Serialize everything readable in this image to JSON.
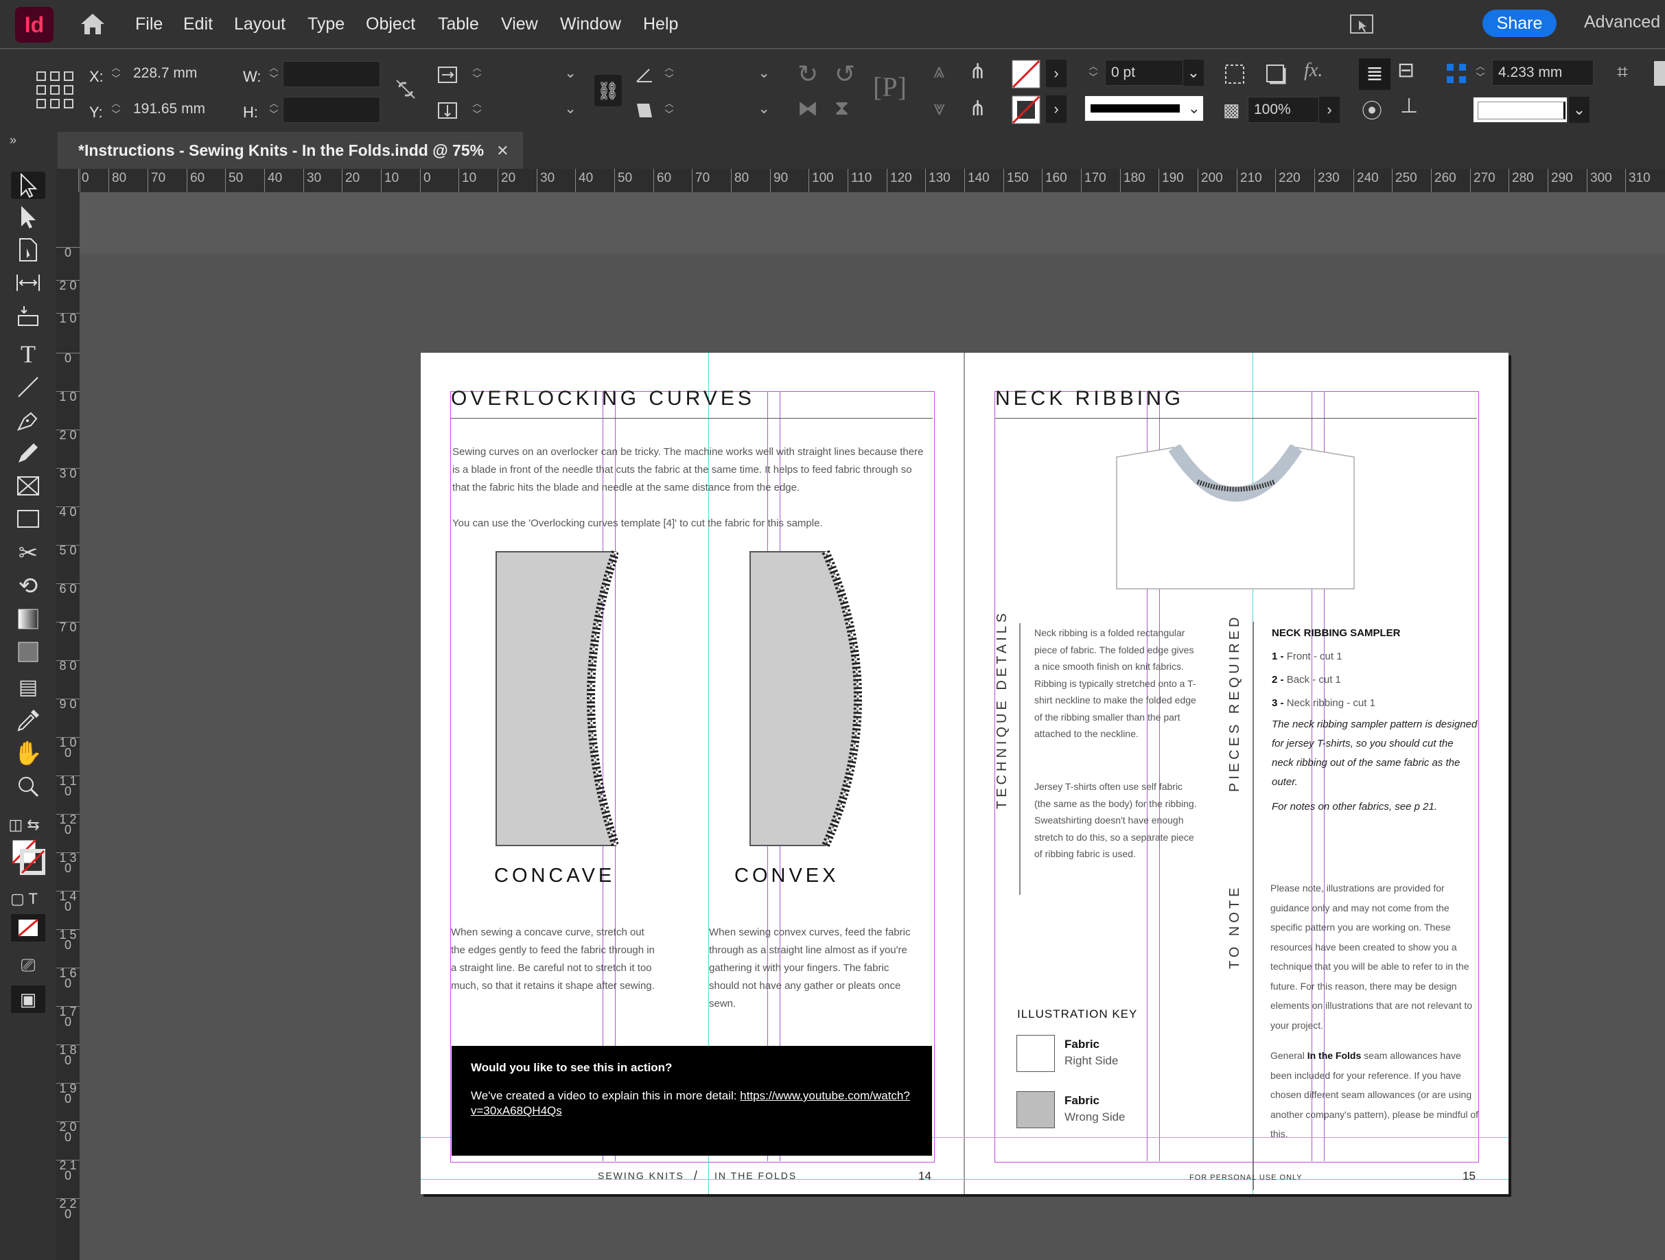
{
  "app": {
    "logo": "Id",
    "menu": [
      "File",
      "Edit",
      "Layout",
      "Type",
      "Object",
      "Table",
      "View",
      "Window",
      "Help"
    ],
    "share_label": "Share",
    "workspace_label": "Advanced"
  },
  "control": {
    "x_label": "X:",
    "x_value": "228.7 mm",
    "y_label": "Y:",
    "y_value": "191.65 mm",
    "w_label": "W:",
    "h_label": "H:",
    "stroke_weight": "0 pt",
    "opacity": "100%",
    "gap_value": "4.233 mm"
  },
  "document": {
    "tab_title": "*Instructions - Sewing Knits - In the Folds.indd @ 75%",
    "tab_close": "✕"
  },
  "ruler": {
    "h_labels": [
      "0",
      "80",
      "70",
      "60",
      "50",
      "40",
      "30",
      "20",
      "10",
      "0",
      "10",
      "20",
      "30",
      "40",
      "50",
      "60",
      "70",
      "80",
      "90",
      "100",
      "110",
      "120",
      "130",
      "140",
      "150",
      "160",
      "170",
      "180",
      "190",
      "200",
      "210",
      "220",
      "230",
      "240",
      "250",
      "260",
      "270",
      "280",
      "290",
      "300",
      "310"
    ],
    "v_labels": [
      "0",
      "2 0",
      "1 0",
      "0",
      "1 0",
      "2 0",
      "3 0",
      "4 0",
      "5 0",
      "6 0",
      "7 0",
      "8 0",
      "9 0",
      "1 0 0",
      "1 1 0",
      "1 2 0",
      "1 3 0",
      "1 4 0",
      "1 5 0",
      "1 6 0",
      "1 7 0",
      "1 8 0",
      "1 9 0",
      "2 0 0",
      "2 1 0",
      "2 2 0"
    ]
  },
  "left_page": {
    "title": "OVERLOCKING CURVES",
    "para1": "Sewing curves on an overlocker can be tricky. The machine works well with straight lines because there is a blade in front of the needle that cuts the fabric at the same time. It helps to feed fabric through so that the fabric hits the blade and needle at the same distance from the edge.",
    "para2": "You can use the 'Overlocking curves template [4]' to cut the fabric for this sample.",
    "concave_label": "CONCAVE",
    "convex_label": "CONVEX",
    "concave_text": "When sewing a concave curve, stretch out the edges gently to feed the fabric through in a straight line. Be careful not to stretch it too much, so that it retains it shape after sewing.",
    "convex_text": "When sewing convex curves, feed the fabric through as a straight line almost as if you're gathering it with your fingers. The fabric should not have any gather or pleats once sewn.",
    "action_title": "Would you like to see this in action?",
    "action_body": "We've created a video to explain this in more detail: ",
    "action_link": "https://www.youtube.com/watch?v=30xA68QH4Qs",
    "footer_left": "SEWING KNITS",
    "footer_slash": "/",
    "footer_right": "IN THE FOLDS",
    "page_number": "14"
  },
  "right_page": {
    "title": "NECK RIBBING",
    "technique_label": "TECHNIQUE DETAILS",
    "technique_p1": "Neck ribbing is a folded rectangular piece of fabric. The folded edge gives a nice smooth finish on knit fabrics. Ribbing is typically stretched onto a T-shirt neckline to make the folded edge of the ribbing smaller than the part attached to the neckline.",
    "technique_p2": "Jersey T-shirts often use self fabric (the same as the body) for the ribbing. Sweatshirting doesn't have enough stretch to do this, so a separate piece of ribbing fabric is used.",
    "pieces_label": "PIECES REQUIRED",
    "sampler_heading": "NECK RIBBING SAMPLER",
    "pieces": [
      {
        "num": "1 -",
        "text": "Front - cut 1"
      },
      {
        "num": "2 -",
        "text": "Back - cut 1"
      },
      {
        "num": "3 -",
        "text": "Neck ribbing - cut 1"
      }
    ],
    "pieces_note": "The neck ribbing sampler pattern is designed for jersey T-shirts, so you should cut the neck ribbing out of the same fabric as the outer.",
    "pieces_note2": "For notes on other fabrics, see p 21.",
    "note_label": "TO NOTE",
    "note_p1": "Please note, illustrations are provided for guidance only and may not come from the specific pattern you are working on. These resources have been created to show you a technique that you will be able to refer to in the future. For this reason, there may be design elements on illustrations that are not relevant to your project.",
    "note_p2_a": "General ",
    "note_p2_b": "In the Folds",
    "note_p2_c": " seam allowances have been included for your reference. If you have chosen different seam allowances (or are using another company's pattern), please be mindful of this.",
    "key_heading": "ILLUSTRATION KEY",
    "key_items": [
      {
        "title": "Fabric",
        "sub": "Right Side",
        "color": "#ffffff"
      },
      {
        "title": "Fabric",
        "sub": "Wrong Side",
        "color": "#bdbdbd"
      }
    ],
    "footer": "FOR PERSONAL USE ONLY",
    "page_number": "15"
  },
  "colors": {
    "accent": "#1473e6",
    "margin_guide": "#c44be0",
    "ruler_guide": "#51d8d8",
    "app_logo_bg": "#49021f",
    "app_logo_fg": "#ff3366"
  }
}
